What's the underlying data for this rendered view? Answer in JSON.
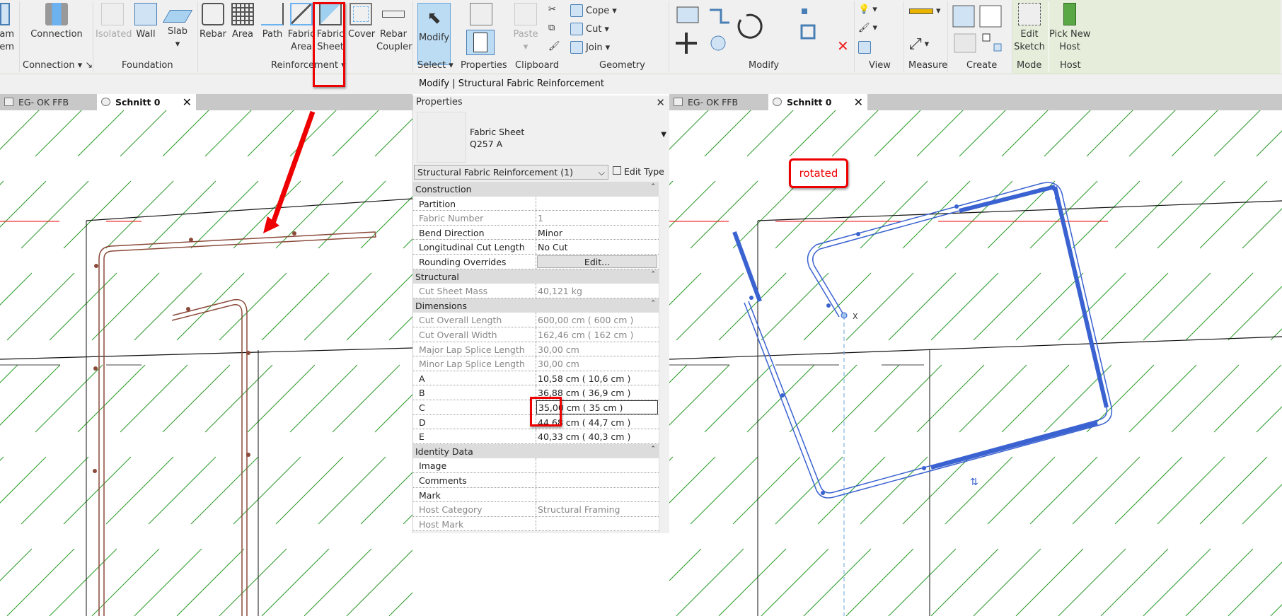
{
  "ribbon": {
    "buttons": {
      "beam_system_partial": "am\ntem",
      "connection": "Connection",
      "isolated": "Isolated",
      "wall": "Wall",
      "slab": "Slab",
      "rebar": "Rebar",
      "area": "Area",
      "path": "Path",
      "fabric_area": "Fabric\nArea",
      "fabric_sheet": "Fabric\nSheet",
      "cover": "Cover",
      "rebar_coupler": "Rebar\nCoupler",
      "modify": "Modify",
      "paste": "Paste",
      "cope": "Cope",
      "cut": "Cut",
      "join": "Join",
      "edit_sketch": "Edit\nSketch",
      "pick_new_host": "Pick New\nHost"
    },
    "groups": {
      "connection": "Connection",
      "foundation": "Foundation",
      "reinforcement": "Reinforcement",
      "select": "Select",
      "properties": "Properties",
      "clipboard": "Clipboard",
      "geometry": "Geometry",
      "modify": "Modify",
      "view": "View",
      "measure": "Measure",
      "create": "Create",
      "mode": "Mode",
      "host": "Host"
    }
  },
  "context_bar": "Modify | Structural Fabric Reinforcement",
  "left_view": {
    "tabs": [
      "EG- OK FFB",
      "Schnitt 0"
    ]
  },
  "right_view": {
    "tabs": [
      "EG- OK FFB",
      "Schnitt 0"
    ],
    "annotation": "rotated",
    "marker": "X"
  },
  "properties": {
    "title": "Properties",
    "type_name": "Fabric Sheet",
    "type_sub": "Q257 A",
    "selector": "Structural Fabric Reinforcement (1)",
    "edit_type": "Edit Type",
    "sections": [
      {
        "name": "Construction",
        "rows": [
          {
            "label": "Partition",
            "value": "",
            "ro": false
          },
          {
            "label": "Fabric Number",
            "value": "1",
            "ro": true
          },
          {
            "label": "Bend Direction",
            "value": "Minor",
            "ro": false
          },
          {
            "label": "Longitudinal Cut Length",
            "value": "No Cut",
            "ro": false
          },
          {
            "label": "Rounding Overrides",
            "value": "Edit...",
            "ro": false,
            "button": true
          }
        ]
      },
      {
        "name": "Structural",
        "rows": [
          {
            "label": "Cut Sheet Mass",
            "value": "40,121 kg",
            "ro": true
          }
        ]
      },
      {
        "name": "Dimensions",
        "rows": [
          {
            "label": "Cut Overall Length",
            "value": "600,00 cm ( 600 cm )",
            "ro": true
          },
          {
            "label": "Cut Overall Width",
            "value": "162,46 cm ( 162 cm )",
            "ro": true
          },
          {
            "label": "Major Lap Splice Length",
            "value": "30,00 cm",
            "ro": true
          },
          {
            "label": "Minor Lap Splice Length",
            "value": "30,00 cm",
            "ro": true
          },
          {
            "label": "A",
            "value": "10,58 cm ( 10,6 cm )",
            "ro": false
          },
          {
            "label": "B",
            "value": "36,88 cm ( 36,9 cm )",
            "ro": false
          },
          {
            "label": "C",
            "value": "35,00 cm ( 35 cm )",
            "ro": false,
            "editing": true
          },
          {
            "label": "D",
            "value": "44,68 cm ( 44,7 cm )",
            "ro": false
          },
          {
            "label": "E",
            "value": "40,33 cm ( 40,3 cm )",
            "ro": false
          }
        ]
      },
      {
        "name": "Identity Data",
        "rows": [
          {
            "label": "Image",
            "value": "",
            "ro": false
          },
          {
            "label": "Comments",
            "value": "",
            "ro": false
          },
          {
            "label": "Mark",
            "value": "",
            "ro": false
          },
          {
            "label": "Host Category",
            "value": "Structural Framing",
            "ro": true
          },
          {
            "label": "Host Mark",
            "value": "",
            "ro": true
          }
        ]
      }
    ]
  },
  "colors": {
    "highlight": "#e00000",
    "rebar": "#8b4a3a",
    "rebar_selected": "#3a62d0",
    "hatch": "#2a9a2a"
  }
}
